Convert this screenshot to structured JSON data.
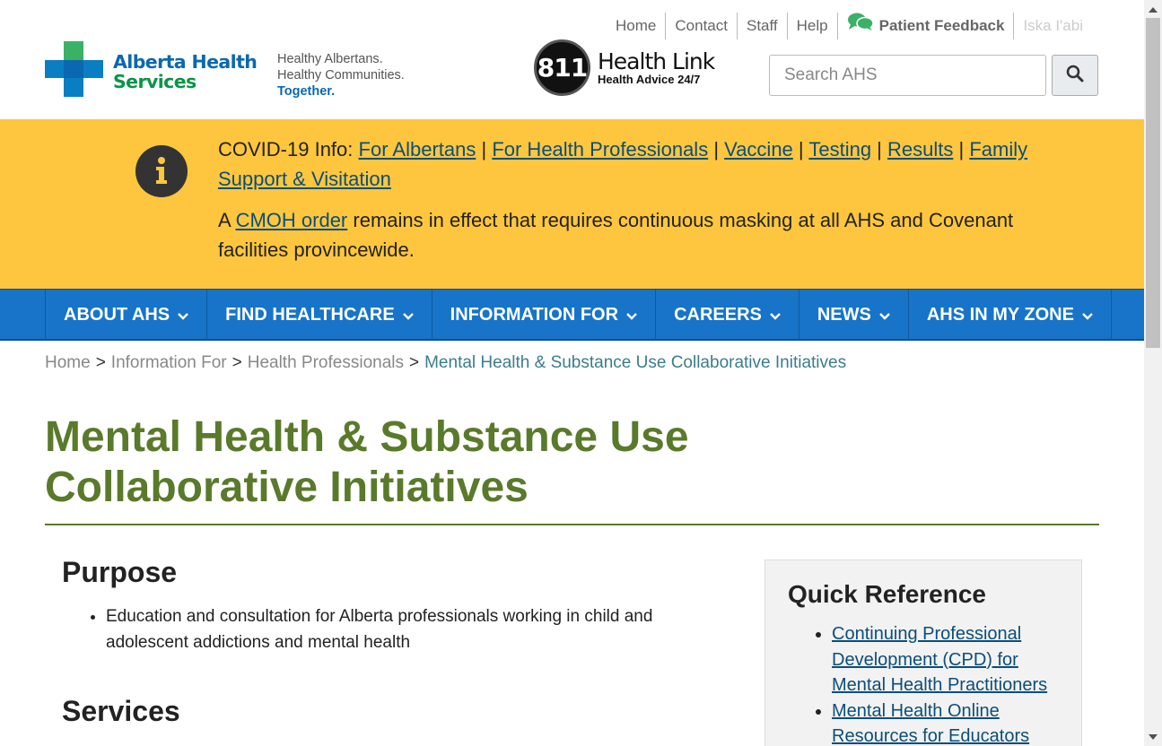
{
  "header": {
    "top_links": [
      "Home",
      "Contact",
      "Staff",
      "Help"
    ],
    "feedback_label": "Patient Feedback",
    "language_label": "Iska I'abi",
    "logo_line1": "Alberta Health",
    "logo_line2": "Services",
    "tagline": [
      "Healthy Albertans.",
      "Healthy Communities.",
      "Together."
    ],
    "healthlink_number": "811",
    "healthlink_title": "Health Link",
    "healthlink_sub": "Health Advice 24/7",
    "search_placeholder": "Search AHS"
  },
  "alert": {
    "prefix": "COVID-19 Info: ",
    "links": [
      "For Albertans",
      "For Health Professionals",
      "Vaccine",
      "Testing",
      "Results",
      "Family Support & Visitation"
    ],
    "separator": " | ",
    "notice_prefix": "A ",
    "notice_link": "CMOH order",
    "notice_rest": " remains in effect that requires continuous masking at all AHS and Covenant facilities provincewide."
  },
  "nav": {
    "items": [
      "ABOUT AHS",
      "FIND HEALTHCARE",
      "INFORMATION FOR",
      "CAREERS",
      "NEWS",
      "AHS IN MY ZONE"
    ]
  },
  "breadcrumb": {
    "items": [
      "Home",
      "Information For",
      "Health Professionals"
    ],
    "separator": ">",
    "current": "Mental Health & Substance Use Collaborative Initiatives"
  },
  "page": {
    "title": "Mental Health & Substance Use Collaborative Initiatives",
    "purpose_heading": "Purpose",
    "purpose_items": [
      "Education and consultation for Alberta professionals working in child and adolescent addictions and mental health"
    ],
    "services_heading": "Services"
  },
  "quick_reference": {
    "heading": "Quick Reference",
    "links": [
      "Continuing Professional Development (CPD) for Mental Health Practitioners",
      "Mental Health Online Resources for Educators"
    ]
  },
  "colors": {
    "brand_blue": "#0a68b0",
    "brand_green": "#0a9447",
    "alert_yellow": "#fdc63e",
    "nav_blue": "#1774c8",
    "title_green": "#5a7a2b"
  }
}
